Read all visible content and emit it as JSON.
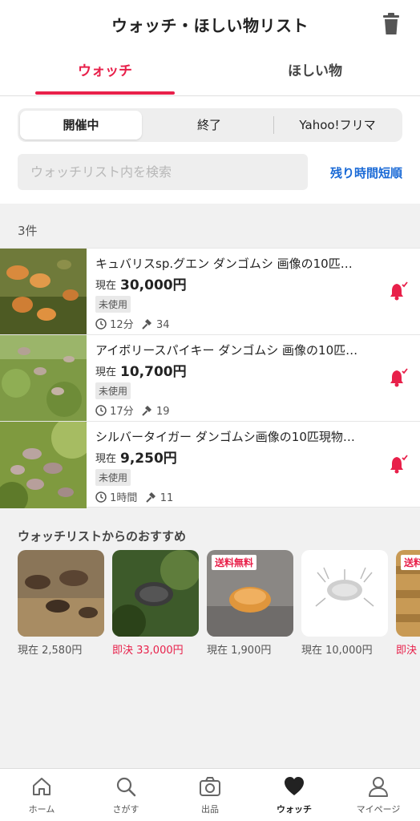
{
  "header": {
    "title": "ウォッチ・ほしい物リスト",
    "trash_icon": "trash-icon"
  },
  "tabs": [
    {
      "label": "ウォッチ",
      "active": true
    },
    {
      "label": "ほしい物",
      "active": false
    }
  ],
  "segments": [
    {
      "label": "開催中",
      "active": true
    },
    {
      "label": "終了",
      "active": false
    },
    {
      "label": "Yahoo!フリマ",
      "active": false
    }
  ],
  "search": {
    "placeholder": "ウォッチリスト内を検索",
    "value": ""
  },
  "sort_link": "残り時間短順",
  "count": "3件",
  "items": [
    {
      "name": "キュバリスsp.グエン ダンゴムシ 画像の10匹…",
      "price_label": "現在",
      "price": "30,000円",
      "condition": "未使用",
      "time": "12分",
      "bids": "34"
    },
    {
      "name": "アイボリースパイキー ダンゴムシ 画像の10匹…",
      "price_label": "現在",
      "price": "10,700円",
      "condition": "未使用",
      "time": "17分",
      "bids": "19"
    },
    {
      "name": "シルバータイガー ダンゴムシ画像の10匹現物…",
      "price_label": "現在",
      "price": "9,250円",
      "condition": "未使用",
      "time": "1時間",
      "bids": "11"
    }
  ],
  "recommend": {
    "title": "ウォッチリストからのおすすめ",
    "cards": [
      {
        "tag": "",
        "price": "現在 2,580円",
        "buy_now": false
      },
      {
        "tag": "",
        "price": "即決 33,000円",
        "buy_now": true
      },
      {
        "tag": "送料無料",
        "price": "現在 1,900円",
        "buy_now": false
      },
      {
        "tag": "",
        "price": "現在 10,000円",
        "buy_now": false
      },
      {
        "tag": "送料",
        "price": "即決",
        "buy_now": true
      }
    ]
  },
  "bottom_nav": [
    {
      "label": "ホーム",
      "icon": "home-icon",
      "active": false
    },
    {
      "label": "さがす",
      "icon": "search-icon",
      "active": false
    },
    {
      "label": "出品",
      "icon": "camera-icon",
      "active": false
    },
    {
      "label": "ウォッチ",
      "icon": "heart-icon",
      "active": true
    },
    {
      "label": "マイページ",
      "icon": "person-icon",
      "active": false
    }
  ],
  "colors": {
    "accent": "#e8204a",
    "link": "#1a6ad6"
  }
}
